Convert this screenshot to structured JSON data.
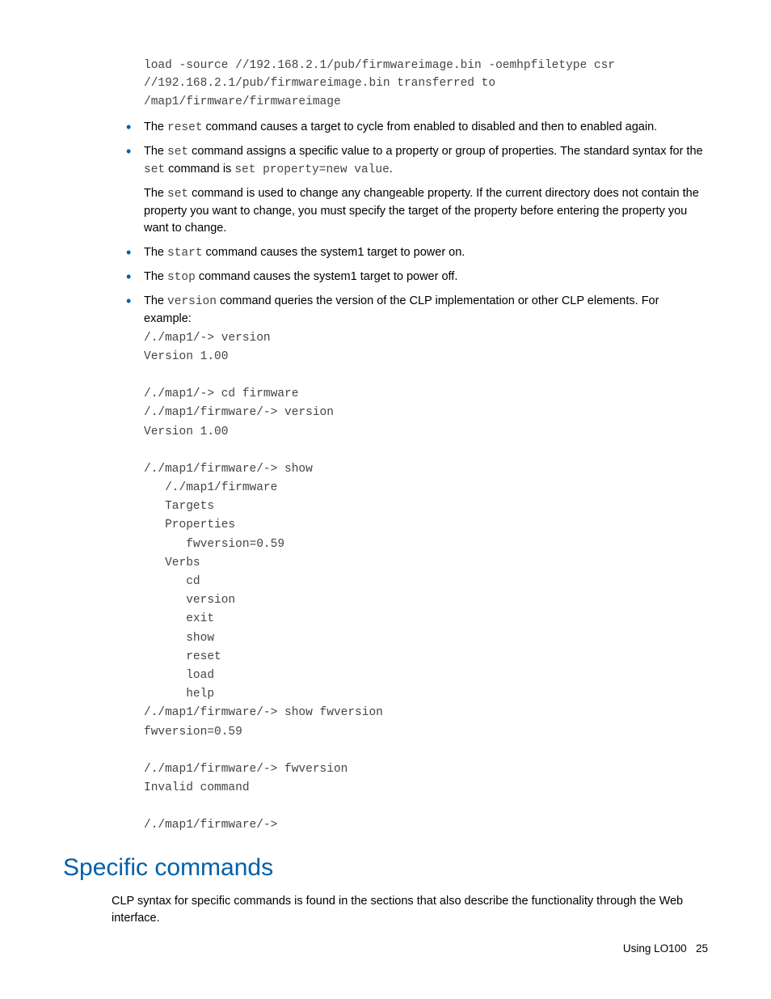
{
  "codeTop": "load -source //192.168.2.1/pub/firmwareimage.bin -oemhpfiletype csr\n//192.168.2.1/pub/firmwareimage.bin transferred to\n/map1/firmware/firmwareimage",
  "bullets": {
    "reset": {
      "pre": "The ",
      "cmd": "reset",
      "post": " command causes a target to cycle from enabled to disabled and then to enabled again."
    },
    "set": {
      "p1_pre": "The ",
      "p1_cmd": "set",
      "p1_mid": " command assigns a specific value to a property or group of properties. The standard syntax for the ",
      "p1_cmd2": "set",
      "p1_mid2": " command is ",
      "p1_code": "set property=new value",
      "p1_end": ".",
      "p2_pre": "The ",
      "p2_cmd": "set",
      "p2_post": " command is used to change any changeable property. If the current directory does not contain the property you want to change, you must specify the target of the property before entering the property you want to change."
    },
    "start": {
      "pre": "The ",
      "cmd": "start",
      "post": " command causes the system1 target to power on."
    },
    "stop": {
      "pre": "The ",
      "cmd": "stop",
      "post": " command causes the system1 target to power off."
    },
    "version": {
      "pre": "The ",
      "cmd": "version",
      "post": " command queries the version of the CLP implementation or other CLP elements. For example:",
      "code": "/./map1/-> version\nVersion 1.00\n\n/./map1/-> cd firmware\n/./map1/firmware/-> version\nVersion 1.00\n\n/./map1/firmware/-> show\n   /./map1/firmware\n   Targets\n   Properties\n      fwversion=0.59\n   Verbs\n      cd\n      version\n      exit\n      show\n      reset\n      load\n      help\n/./map1/firmware/-> show fwversion\nfwversion=0.59\n\n/./map1/firmware/-> fwversion\nInvalid command\n\n/./map1/firmware/->"
    }
  },
  "section": {
    "title": "Specific commands",
    "body": "CLP syntax for specific commands is found in the sections that also describe the functionality through the Web interface."
  },
  "footer": {
    "label": "Using LO100",
    "page": "25"
  }
}
